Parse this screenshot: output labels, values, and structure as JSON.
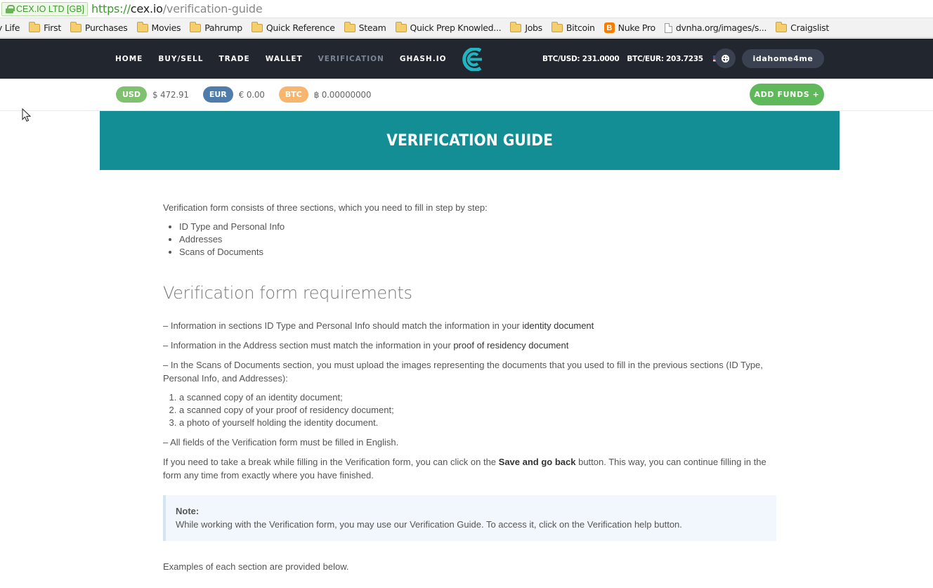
{
  "browser": {
    "ev_cert": "CEX.IO LTD [GB]",
    "url_scheme": "https://",
    "url_host": "cex.io",
    "url_path": "/verification-guide",
    "bookmarks": [
      {
        "label": "y Life",
        "icon": "none"
      },
      {
        "label": "First",
        "icon": "folder-icon"
      },
      {
        "label": "Purchases",
        "icon": "folder-icon"
      },
      {
        "label": "Movies",
        "icon": "folder-icon"
      },
      {
        "label": "Pahrump",
        "icon": "folder-icon"
      },
      {
        "label": "Quick Reference",
        "icon": "folder-icon"
      },
      {
        "label": "Steam",
        "icon": "folder-icon"
      },
      {
        "label": "Quick Prep Knowled...",
        "icon": "folder-icon"
      },
      {
        "label": "Jobs",
        "icon": "folder-icon"
      },
      {
        "label": "Bitcoin",
        "icon": "folder-icon"
      },
      {
        "label": "Nuke Pro",
        "icon": "blogger-icon"
      },
      {
        "label": "dvnha.org/images/s...",
        "icon": "page-icon"
      },
      {
        "label": "Craigslist",
        "icon": "folder-icon"
      }
    ]
  },
  "nav": {
    "items": [
      {
        "label": "HOME",
        "active": false
      },
      {
        "label": "BUY/SELL",
        "active": false
      },
      {
        "label": "TRADE",
        "active": false
      },
      {
        "label": "WALLET",
        "active": false
      },
      {
        "label": "VERIFICATION",
        "active": true
      },
      {
        "label": "GHASH.IO",
        "active": false
      }
    ],
    "btc_usd": "BTC/USD: 231.0000",
    "btc_eur": "BTC/EUR: 203.7235",
    "username": "idahome4me",
    "logo_color": "#1fb6c1"
  },
  "balances": {
    "items": [
      {
        "currency": "USD",
        "value": "$ 472.91",
        "color": "#7ec270"
      },
      {
        "currency": "EUR",
        "value": "€ 0.00",
        "color": "#4f7dab"
      },
      {
        "currency": "BTC",
        "value": "฿ 0.00000000",
        "color": "#f8b56e"
      }
    ],
    "add_funds": "ADD FUNDS +"
  },
  "hero": {
    "title": "VERIFICATION GUIDE",
    "color": "#138e95"
  },
  "content": {
    "intro": "Verification form consists of three sections, which you need to fill in step by step:",
    "sections": [
      "ID Type and Personal Info",
      "Addresses",
      "Scans of Documents"
    ],
    "heading": "Verification form requirements",
    "req1_text": "– Information in sections ID Type and Personal Info should match the information in your ",
    "req1_em": "identity document",
    "req2_text": "– Information in the Address section must match the information in your ",
    "req2_em": "proof of residency document",
    "req3": "– In the Scans of Documents section, you must upload the images representing the documents that you used to fill in the previous sections (ID Type, Personal Info, and Addresses):",
    "docs": [
      "a scanned copy of an identity document;",
      "a scanned copy of your proof of residency document;",
      "a photo of yourself holding the identity document."
    ],
    "req4": "– All fields of the Verification form must be filled in English.",
    "break_pre": "If you need to take a break while filling in the Verification form, you can click on the ",
    "break_bold": "Save and go back",
    "break_post": " button. This way, you can continue filling in the form any time from exactly where you have finished.",
    "note_title": "Note:",
    "note_text": "While working with the Verification form, you may use our Verification Guide. To access it, click on the Verification help button.",
    "examples": "Examples of each section are provided below."
  }
}
